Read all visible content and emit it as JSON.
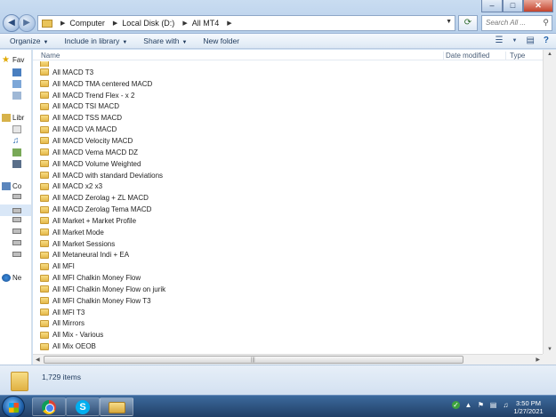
{
  "address": {
    "crumbs": [
      "Computer",
      "Local Disk (D:)",
      "All MT4"
    ],
    "search_placeholder": "Search All ..."
  },
  "toolbar": {
    "organize": "Organize",
    "include_in_library": "Include in library",
    "share_with": "Share with",
    "new_folder": "New folder"
  },
  "nav": {
    "favorites": "Fav",
    "libraries": "Libr",
    "computer": "Co",
    "network": "Ne"
  },
  "columns": {
    "name": "Name",
    "date_modified": "Date modified",
    "type": "Type"
  },
  "files": [
    "All  MACD T3",
    "All  MACD TMA centered MACD",
    "All  MACD Trend Flex -  x 2",
    "All  MACD TSI MACD",
    "All  MACD TSS MACD",
    "All  MACD VA MACD",
    "All  MACD Velocity MACD",
    "All  MACD Vema MACD DZ",
    "All  MACD Volume Weighted",
    "All  MACD with standard Deviations",
    "All  MACD x2 x3",
    "All  MACD Zerolag + ZL MACD",
    "All  MACD Zerolag Tema MACD",
    "All  Market + Market Profile",
    "All  Market Mode",
    "All  Market Sessions",
    "All  Metaneural Indi + EA",
    "All  MFI",
    "All  MFI Chalkin Money Flow",
    "All  MFI Chalkin Money Flow on jurik",
    "All  MFI Chalkin Money Flow T3",
    "All  MFI T3",
    "All  Mirrors",
    "All  Mix - Various",
    "All  Mix OEOB"
  ],
  "status": {
    "item_count": "1,729 items"
  },
  "taskbar": {
    "time": "3:50 PM",
    "date": "1/27/2021"
  }
}
